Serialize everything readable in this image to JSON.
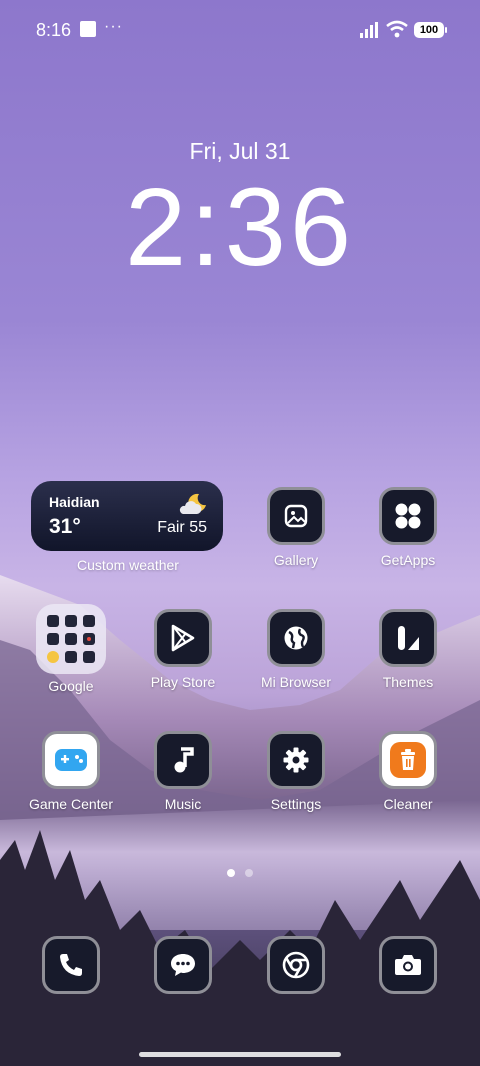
{
  "status_bar": {
    "time": "8:16",
    "dots": "···",
    "battery": "100"
  },
  "lock": {
    "date": "Fri, Jul 31",
    "time": "2:36"
  },
  "weather": {
    "city": "Haidian",
    "temp": "31°",
    "condition": "Fair 55",
    "label": "Custom weather",
    "icon": "partly-cloudy-night-icon"
  },
  "apps": [
    {
      "label": "Gallery",
      "icon": "image-icon"
    },
    {
      "label": "GetApps",
      "icon": "four-dots-icon"
    },
    {
      "label": "Google",
      "icon": "folder-icon"
    },
    {
      "label": "Play Store",
      "icon": "play-triangle-icon"
    },
    {
      "label": "Mi Browser",
      "icon": "globe-icon"
    },
    {
      "label": "Themes",
      "icon": "themes-icon"
    },
    {
      "label": "Game Center",
      "icon": "gamepad-icon"
    },
    {
      "label": "Music",
      "icon": "music-note-icon"
    },
    {
      "label": "Settings",
      "icon": "gear-icon"
    },
    {
      "label": "Cleaner",
      "icon": "trash-icon"
    }
  ],
  "dock": [
    {
      "name": "Phone",
      "icon": "phone-icon"
    },
    {
      "name": "Messages",
      "icon": "chat-bubble-icon"
    },
    {
      "name": "Chrome",
      "icon": "chrome-icon"
    },
    {
      "name": "Camera",
      "icon": "camera-icon"
    }
  ],
  "pager": {
    "pages": 2,
    "current": 1
  },
  "colors": {
    "icon_bg": "#171a2b",
    "icon_border": "#8f8f97",
    "cleaner": "#f07a1c",
    "game_center": "#32a6f0"
  }
}
